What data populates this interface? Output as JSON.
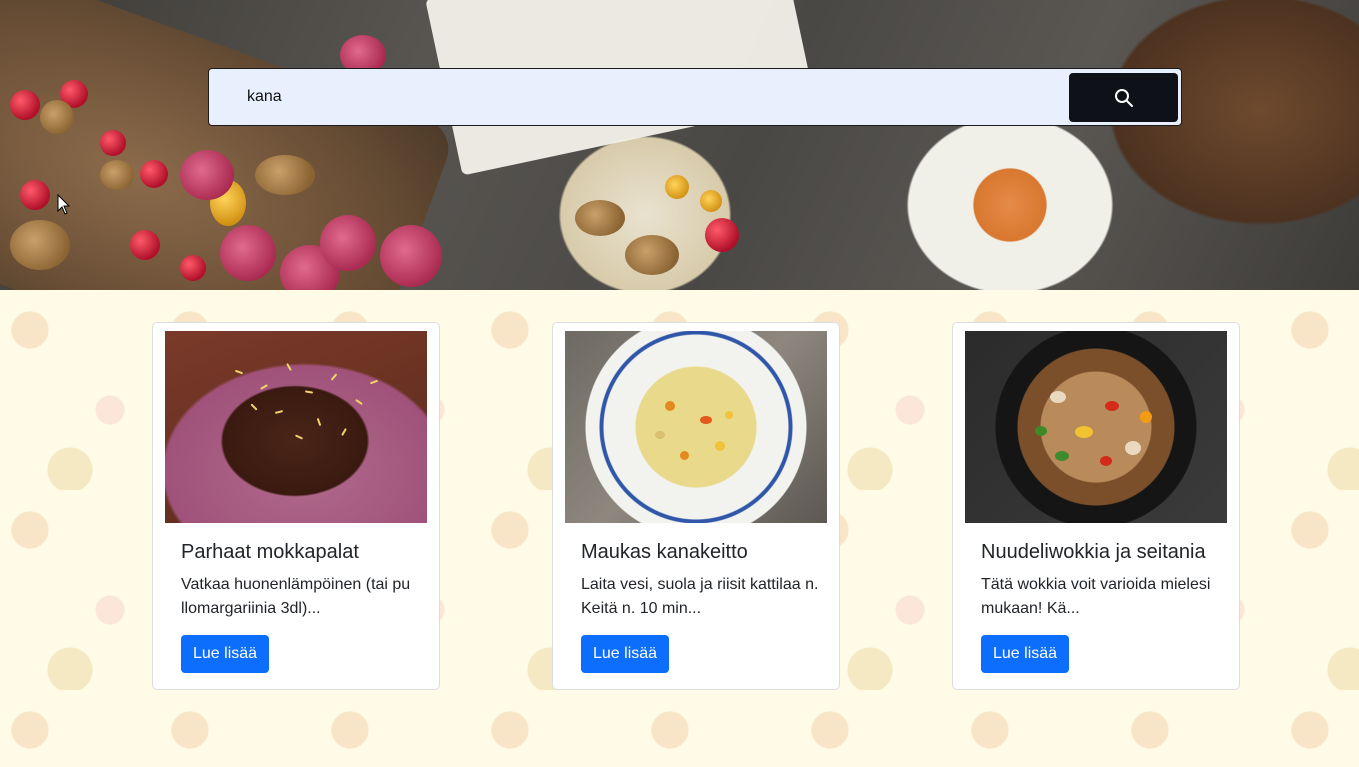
{
  "search": {
    "value": "kana",
    "button_icon": "search-icon"
  },
  "colors": {
    "search_bg": "#e8f0fe",
    "search_button": "#0e1118",
    "primary_button": "#0d6efd",
    "content_bg": "#fffbe6"
  },
  "recipes": [
    {
      "title": "Parhaat mokkapalat",
      "description": "Vatkaa huonenlämpöinen (tai pu llomargariinia 3dl)...",
      "button_label": "Lue lisää",
      "image": "chocolate-cake-image"
    },
    {
      "title": "Maukas kanakeitto",
      "description": "Laita vesi, suola ja riisit kattilaa n. Keitä n. 10 min...",
      "button_label": "Lue lisää",
      "image": "chicken-soup-image"
    },
    {
      "title": "Nuudeliwokkia ja seitania",
      "description": "Tätä wokkia voit varioida mielesi mukaan! Kä...",
      "button_label": "Lue lisää",
      "image": "noodle-wok-image"
    }
  ]
}
